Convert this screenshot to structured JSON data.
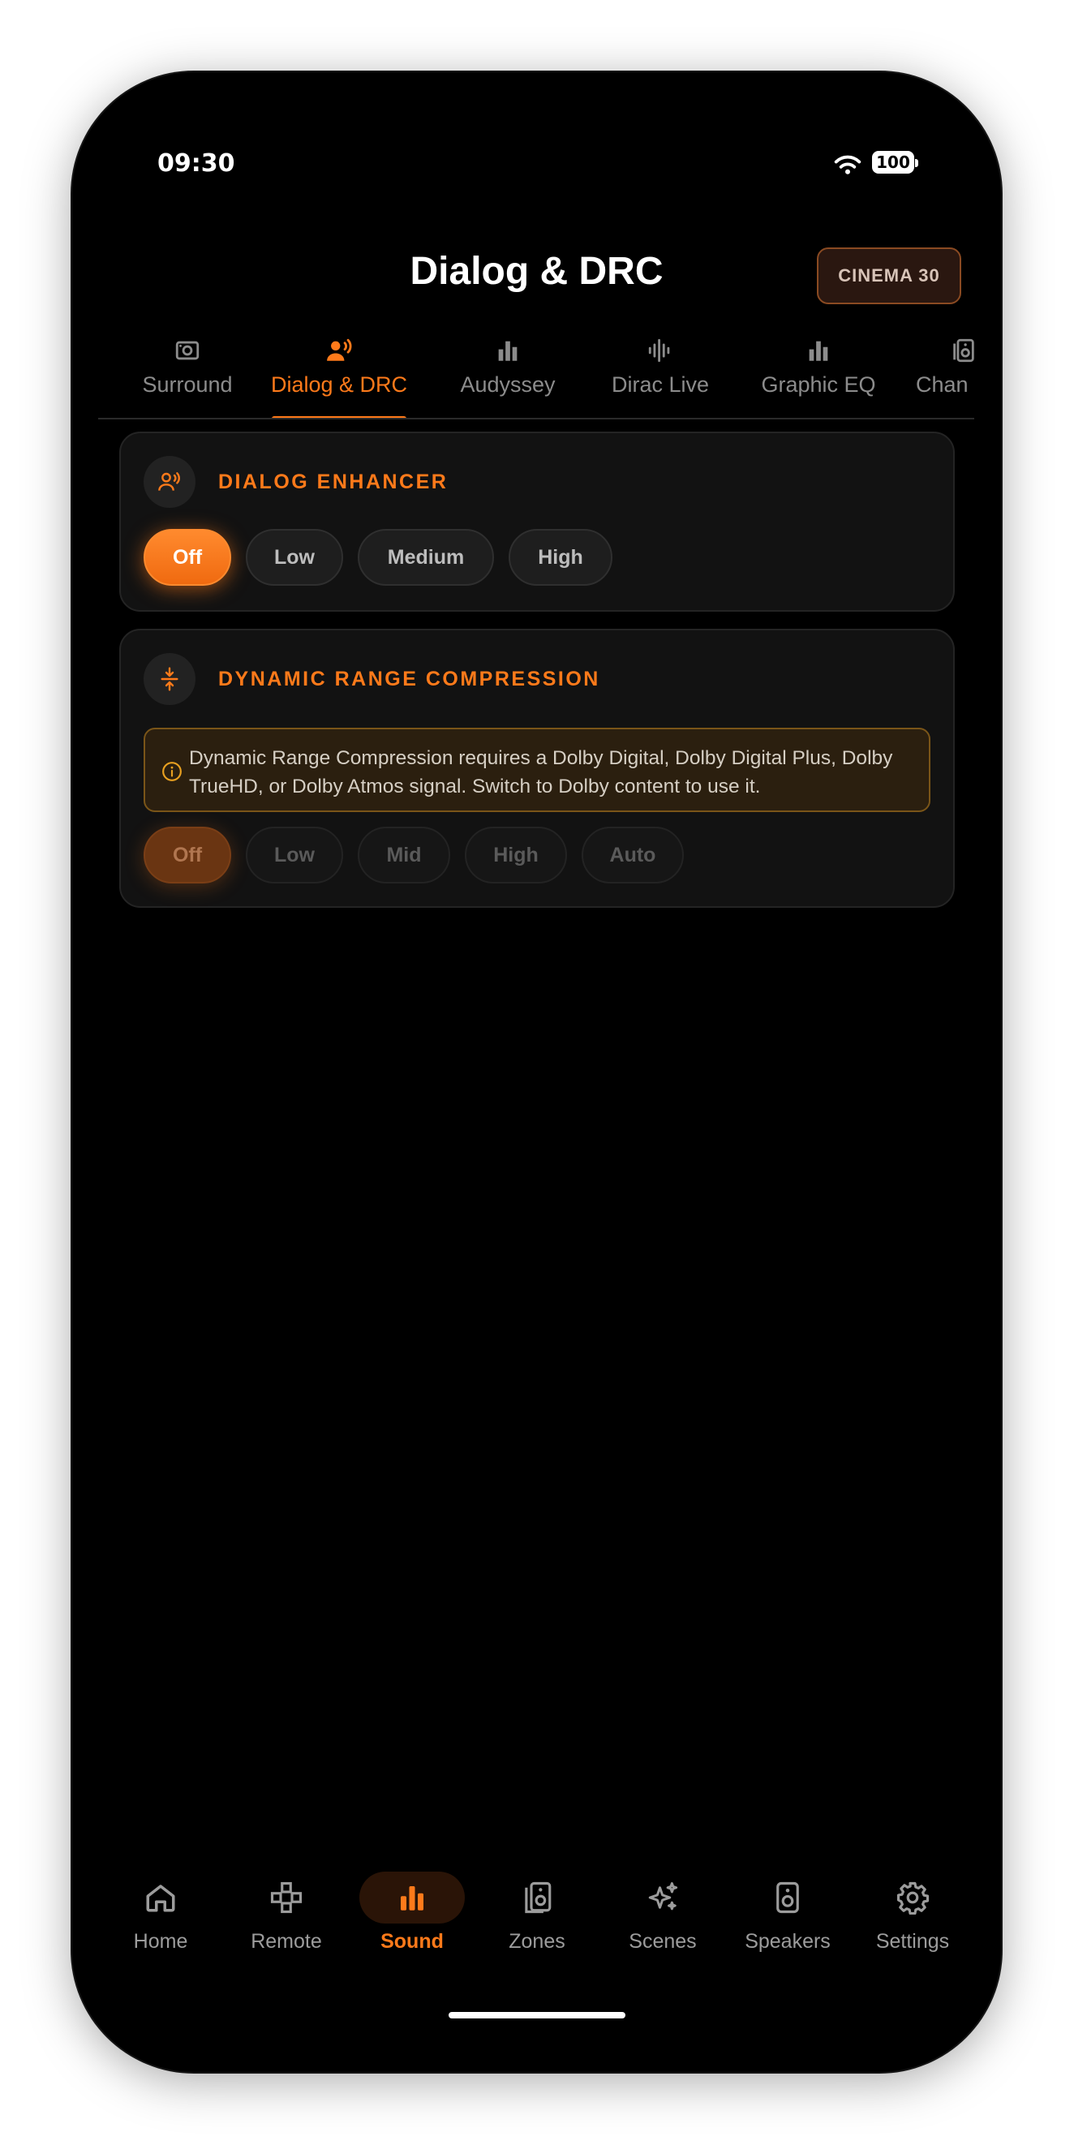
{
  "status_bar": {
    "time": "09:30",
    "battery": "100"
  },
  "header": {
    "title": "Dialog & DRC",
    "preset_badge": "CINEMA 30"
  },
  "tabs": [
    {
      "label": "Surround",
      "icon": "surround-speaker-icon",
      "active": false
    },
    {
      "label": "Dialog & DRC",
      "icon": "voice-person-icon",
      "active": true
    },
    {
      "label": "Audyssey",
      "icon": "bar-chart-icon",
      "active": false
    },
    {
      "label": "Dirac Live",
      "icon": "waveform-icon",
      "active": false
    },
    {
      "label": "Graphic EQ",
      "icon": "bar-chart-icon",
      "active": false
    },
    {
      "label": "Chan",
      "icon": "speaker-stack-icon",
      "active": false
    }
  ],
  "dialog_enhancer": {
    "title": "DIALOG ENHANCER",
    "icon": "voice-person-icon",
    "options": [
      "Off",
      "Low",
      "Medium",
      "High"
    ],
    "selected": "Off"
  },
  "drc": {
    "title": "DYNAMIC RANGE COMPRESSION",
    "icon": "compress-arrows-icon",
    "notice": "Dynamic Range Compression requires a Dolby Digital, Dolby Digital Plus, Dolby TrueHD, or Dolby Atmos signal. Switch to Dolby content to use it.",
    "options": [
      "Off",
      "Low",
      "Mid",
      "High",
      "Auto"
    ],
    "selected": "Off",
    "disabled": true
  },
  "bottom_nav": [
    {
      "label": "Home",
      "icon": "home-icon",
      "active": false
    },
    {
      "label": "Remote",
      "icon": "gamepad-icon",
      "active": false
    },
    {
      "label": "Sound",
      "icon": "bar-chart-icon",
      "active": true
    },
    {
      "label": "Zones",
      "icon": "speaker-stack-icon",
      "active": false
    },
    {
      "label": "Scenes",
      "icon": "sparkles-icon",
      "active": false
    },
    {
      "label": "Speakers",
      "icon": "speaker-icon",
      "active": false
    },
    {
      "label": "Settings",
      "icon": "gear-icon",
      "active": false
    }
  ],
  "colors": {
    "accent": "#ff7a1a",
    "background": "#000000",
    "card": "#121212",
    "notice_bg": "#2b1f0f"
  }
}
